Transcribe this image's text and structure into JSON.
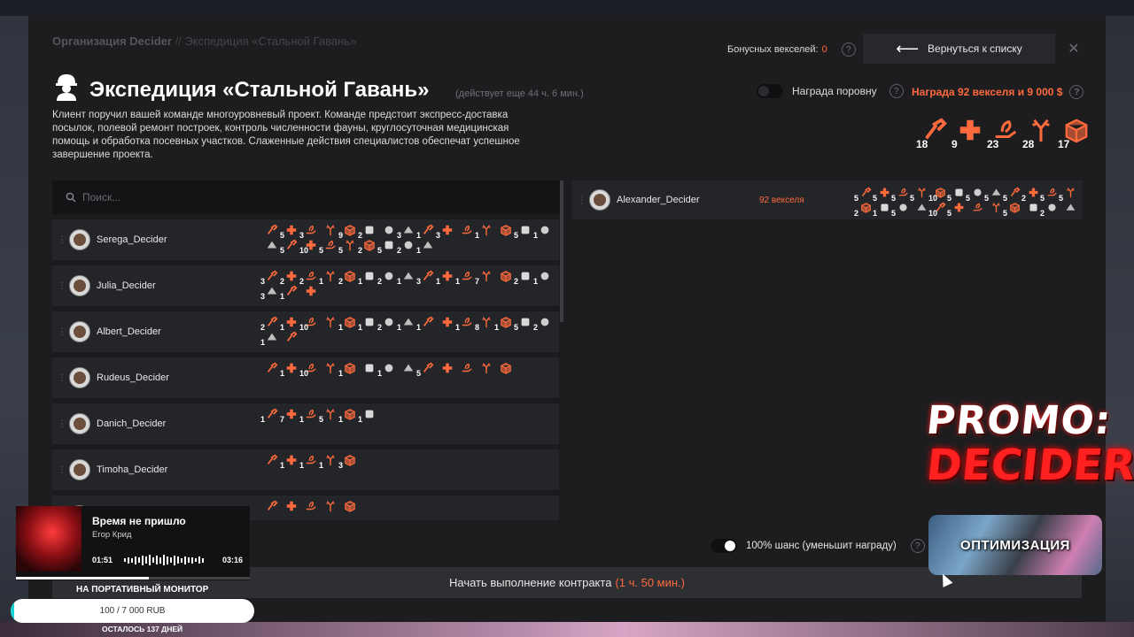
{
  "breadcrumb": {
    "org": "Организация Decider",
    "separator": "//",
    "current": "Экспедиция «Стальной Гавань»"
  },
  "bonus": {
    "label": "Бонусных векселей:",
    "value": "0"
  },
  "back_button": {
    "label": "Вернуться к списку"
  },
  "contract": {
    "title": "Экспедиция «Стальной Гавань»",
    "time_left": "(действует еще 44 ч. 6 мин.)",
    "description": "Клиент поручил вашей команде многоуровневый проект. Команде предстоит экспресс-доставка посылок, полевой ремонт построек, контроль численности фауны, круглосуточная медицинская помощь и обработка посевных участков. Слаженные действия специалистов обеспечат успешное завершение проекта."
  },
  "reward": {
    "even_label": "Награда поровну",
    "total": "Награда 92 векселя и 9 000 $"
  },
  "required_skills": [
    {
      "icon": "hammer-wrench-icon",
      "value": "18"
    },
    {
      "icon": "medical-cross-icon",
      "value": "9"
    },
    {
      "icon": "plant-hand-icon",
      "value": "23"
    },
    {
      "icon": "antlers-icon",
      "value": "28"
    },
    {
      "icon": "box-icon",
      "value": "17"
    }
  ],
  "search": {
    "placeholder": "Поиск..."
  },
  "members": [
    {
      "name": "Serega_Decider",
      "skills": [
        "",
        "5",
        "3",
        "",
        "9",
        "2",
        "",
        "3",
        "1",
        "3",
        "",
        "1",
        "",
        "5",
        "1",
        "",
        "5",
        "10",
        "5",
        "5",
        "2",
        "5",
        "2",
        "1"
      ]
    },
    {
      "name": "Julia_Decider",
      "skills": [
        "3",
        "2",
        "2",
        "1",
        "2",
        "1",
        "2",
        "1",
        "3",
        "1",
        "1",
        "7",
        "",
        "2",
        "1",
        "3",
        "1",
        ""
      ]
    },
    {
      "name": "Albert_Decider",
      "skills": [
        "2",
        "1",
        "10",
        "",
        "1",
        "1",
        "2",
        "1",
        "1",
        "",
        "1",
        "8",
        "1",
        "5",
        "2",
        "1",
        ""
      ]
    },
    {
      "name": "Rudeus_Decider",
      "skills": [
        "",
        "1",
        "10",
        "",
        "1",
        "",
        "1",
        "",
        "5",
        "",
        "",
        "",
        ""
      ]
    },
    {
      "name": "Danich_Decider",
      "skills": [
        "1",
        "7",
        "1",
        "5",
        "1",
        "1"
      ]
    },
    {
      "name": "Timoha_Decider",
      "skills": [
        "",
        "1",
        "1",
        "1",
        "3"
      ]
    },
    {
      "name": "",
      "skills": [
        "",
        "",
        "",
        "",
        ""
      ]
    }
  ],
  "team": [
    {
      "name": "Alexander_Decider",
      "reward": "92 векселя",
      "skills": [
        "5",
        "5",
        "5",
        "5",
        "10",
        "5",
        "5",
        "5",
        "5",
        "2",
        "5",
        "5",
        "2",
        "1",
        "5",
        "",
        "10",
        "5",
        "",
        "",
        "5",
        "",
        "2",
        ""
      ]
    }
  ],
  "chance": {
    "label": "100% шанс (уменьшит награду)"
  },
  "start": {
    "label": "Начать выполнение контракта",
    "time": "(1 ч. 50 мин.)"
  },
  "overlay": {
    "promo_line1": "PROMO:",
    "promo_line2": "DECIDER",
    "optimization": "ОПТИМИЗАЦИЯ",
    "song": "Время не пришло",
    "artist": "Егор Крид",
    "time_current": "01:51",
    "time_total": "03:16",
    "song_progress": 0.57,
    "portable": "НА ПОРТАТИВНЫЙ МОНИТОР",
    "donate": "100 / 7 000 RUB",
    "donate_progress": 0.014,
    "remaining": "ОСТАЛОСЬ 137 ДНЕЙ"
  },
  "colors": {
    "accent": "#ff6a3d",
    "panel": "#1d1d1f",
    "row": "#242528"
  }
}
